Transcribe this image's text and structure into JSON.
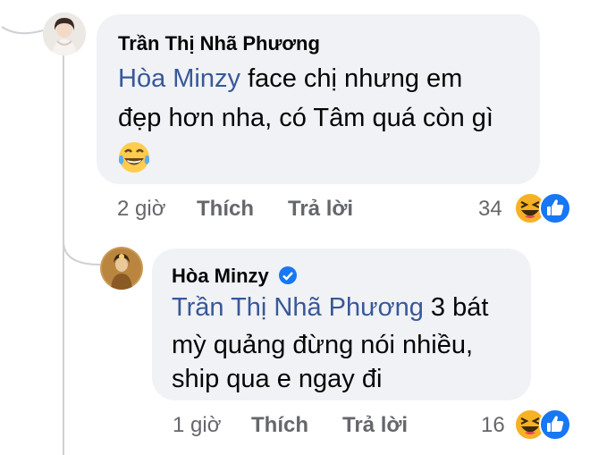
{
  "comment": {
    "author": "Trần Thị Nhã Phương",
    "mention": "Hòa Minzy",
    "text_line1": "face chị nhưng em",
    "text_line2": "đẹp hơn nha, có Tâm quá còn gì",
    "emoji_icon": "laughing-tears-emoji-icon",
    "time": "2 giờ",
    "like_label": "Thích",
    "reply_label": "Trả lời",
    "reaction_count": "34"
  },
  "reply": {
    "author": "Hòa Minzy",
    "verified_icon": "verified-badge-icon",
    "mention": "Trần Thị Nhã Phương",
    "text_line1": "3 bát",
    "text_line2": "mỳ quảng đừng nói nhiều,",
    "text_line3": "ship qua e ngay đi",
    "time": "1 giờ",
    "like_label": "Thích",
    "reply_label": "Trả lời",
    "reaction_count": "16"
  },
  "colors": {
    "bubble": "#f0f2f5",
    "mention": "#385898",
    "meta": "#65676b",
    "like_blue": "#1877f2",
    "haha_yellow": "#f7b125",
    "verified": "#1877f2"
  }
}
